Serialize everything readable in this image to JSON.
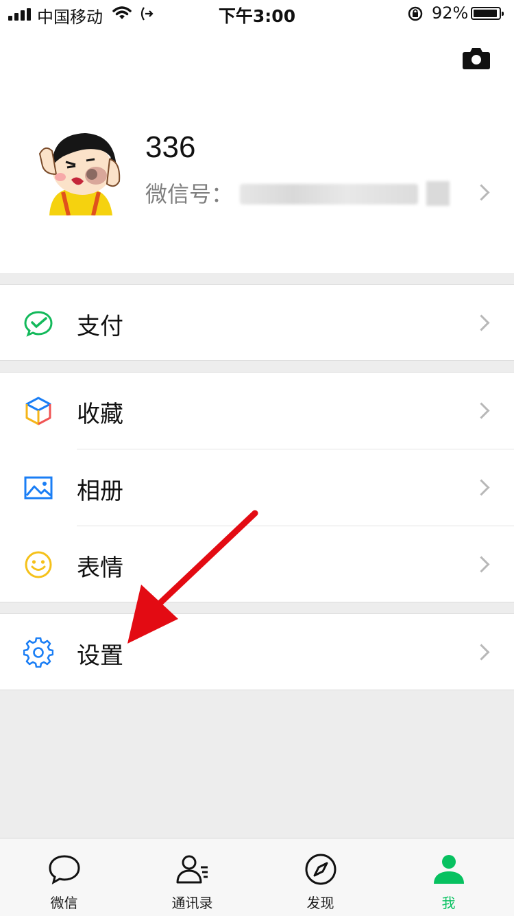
{
  "status_bar": {
    "carrier": "中国移动",
    "time": "下午3:00",
    "battery": "92%",
    "battery_level": 0.92
  },
  "profile": {
    "name": "336",
    "wechat_id_label": "微信号："
  },
  "menu": {
    "pay": "支付",
    "favorites": "收藏",
    "album": "相册",
    "stickers": "表情",
    "settings": "设置"
  },
  "tabs": [
    {
      "label": "微信"
    },
    {
      "label": "通讯录"
    },
    {
      "label": "发现"
    },
    {
      "label": "我"
    }
  ],
  "colors": {
    "accent": "#07c160",
    "pay_icon": "#13b95b",
    "blue_icon": "#1a7ef5",
    "sticker_icon": "#f5c11a",
    "annotation_arrow": "#e30b13"
  }
}
